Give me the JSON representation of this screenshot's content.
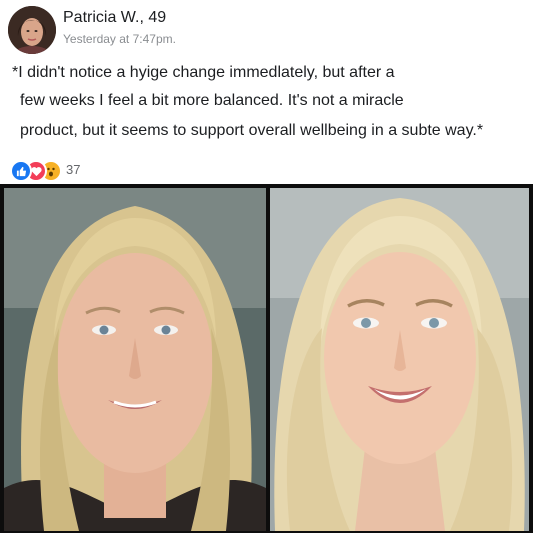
{
  "post": {
    "author_name": "Patricia W., 49",
    "timestamp": "Yesterday at 7:47pm.",
    "body_lines": [
      "*I didn't notice a hyige change immedlately, but after a",
      "few weeks I feel a bit more balanced. It's not a miracle",
      "product, but it seems to support overall wellbeing in a subte way.*"
    ]
  },
  "reactions": {
    "icons": [
      "like-icon",
      "love-icon",
      "wow-icon"
    ],
    "colors": [
      "#1877f2",
      "#f33e58",
      "#f7b125"
    ],
    "count": "37"
  },
  "photos": [
    {
      "name": "before-photo"
    },
    {
      "name": "after-photo"
    }
  ]
}
